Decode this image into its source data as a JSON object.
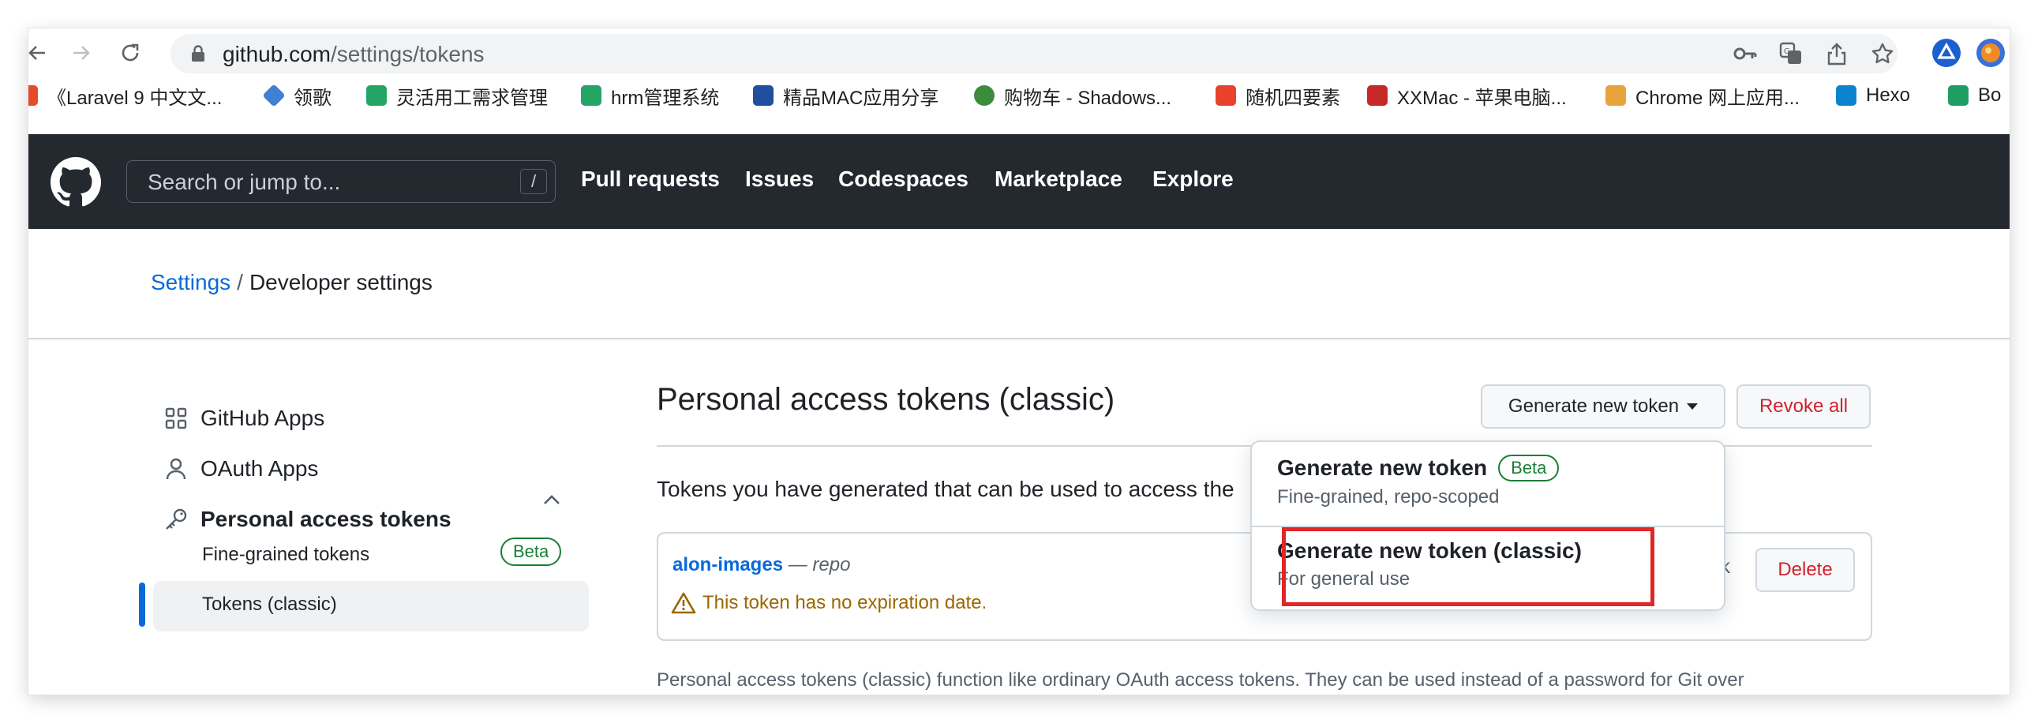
{
  "browser": {
    "url_host": "github.com",
    "url_path": "/settings/tokens",
    "bookmarks": [
      {
        "label": "《Laravel 9 中文文...",
        "color": "#e34c26"
      },
      {
        "label": "领歌",
        "color": "#3f7fd6"
      },
      {
        "label": "灵活用工需求管理",
        "color": "#23a566"
      },
      {
        "label": "hrm管理系统",
        "color": "#23a566"
      },
      {
        "label": "精品MAC应用分享",
        "color": "#1f4f9e"
      },
      {
        "label": "购物车 - Shadows...",
        "color": "#3c8c3c"
      },
      {
        "label": "随机四要素",
        "color": "#e8412c"
      },
      {
        "label": "XXMac - 苹果电脑...",
        "color": "#c62828"
      },
      {
        "label": "Chrome 网上应用...",
        "color": "#e8a33c"
      },
      {
        "label": "Hexo",
        "color": "#0e83cd"
      },
      {
        "label": "Bo",
        "color": "#1e9e64"
      }
    ]
  },
  "header": {
    "search_placeholder": "Search or jump to...",
    "search_key": "/",
    "nav": [
      "Pull requests",
      "Issues",
      "Codespaces",
      "Marketplace",
      "Explore"
    ]
  },
  "breadcrumb": {
    "root": "Settings",
    "separator": "/",
    "current": "Developer settings"
  },
  "sidebar": {
    "items": [
      {
        "label": "GitHub Apps"
      },
      {
        "label": "OAuth Apps"
      },
      {
        "label": "Personal access tokens"
      }
    ],
    "sub_items": [
      {
        "label": "Fine-grained tokens",
        "badge": "Beta"
      },
      {
        "label": "Tokens (classic)"
      }
    ]
  },
  "main": {
    "title": "Personal access tokens (classic)",
    "generate_button": "Generate new token",
    "revoke_button": "Revoke all",
    "intro": "Tokens you have generated that can be used to access the",
    "token": {
      "name": "alon-images",
      "dash": "—",
      "scope": "repo",
      "warning": "This token has no expiration date.",
      "trailing_char": "k",
      "delete_button": "Delete"
    },
    "footer": "Personal access tokens (classic) function like ordinary OAuth access tokens. They can be used instead of a password for Git over"
  },
  "dropdown": {
    "items": [
      {
        "title": "Generate new token",
        "badge": "Beta",
        "desc": "Fine-grained, repo-scoped"
      },
      {
        "title": "Generate new token (classic)",
        "desc": "For general use"
      }
    ]
  },
  "colors": {
    "accent": "#0969da",
    "danger": "#cf222e",
    "success": "#1a7f37",
    "attention": "#9a6700",
    "header_bg": "#24292f",
    "highlight": "#e22626"
  }
}
